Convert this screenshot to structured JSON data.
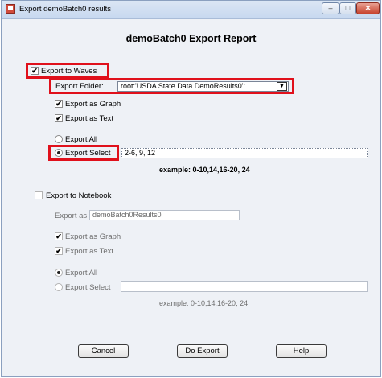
{
  "window": {
    "title": "Export demoBatch0 results"
  },
  "heading": "demoBatch0 Export Report",
  "waves": {
    "export_label": "Export to Waves",
    "export_checked": true,
    "folder_label": "Export Folder:",
    "folder_value": "root:'USDA State Data DemoResults0':",
    "as_graph_label": "Export as Graph",
    "as_graph_checked": true,
    "as_text_label": "Export as Text",
    "as_text_checked": true,
    "export_all_label": "Export All",
    "export_select_label": "Export Select",
    "selected_option": "Export Select",
    "select_value": "2-6, 9, 12",
    "example": "example: 0-10,14,16-20, 24"
  },
  "notebook": {
    "export_label": "Export to Notebook",
    "export_checked": false,
    "export_as_label": "Export as",
    "export_as_value": "demoBatch0Results0",
    "as_graph_label": "Export as Graph",
    "as_graph_checked": true,
    "as_text_label": "Export as Text",
    "as_text_checked": true,
    "export_all_label": "Export All",
    "export_select_label": "Export Select",
    "selected_option": "Export All",
    "select_value": "",
    "example": "example: 0-10,14,16-20, 24"
  },
  "buttons": {
    "cancel": "Cancel",
    "do_export": "Do Export",
    "help": "Help"
  },
  "glyphs": {
    "check": "✔",
    "dropdown": "▼",
    "minimize": "–",
    "maximize": "□",
    "close": "✕"
  },
  "colors": {
    "highlight": "#e0101b",
    "titlebar": "#c7d8ef"
  }
}
